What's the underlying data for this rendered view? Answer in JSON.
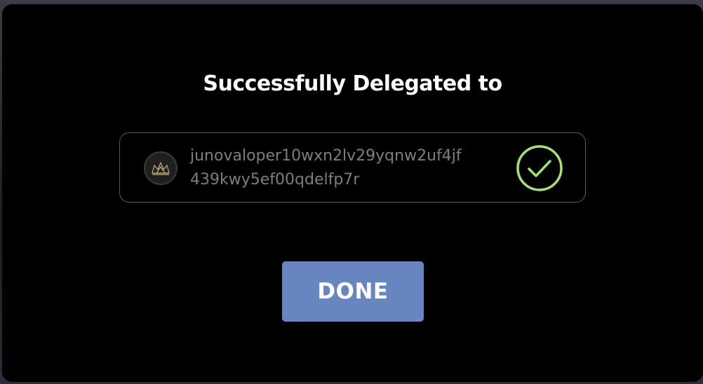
{
  "modal": {
    "title": "Successfully Delegated to",
    "validator": {
      "address_line1": "junovaloper10wxn2lv29yqnw2uf4jf",
      "address_line2": "439kwy5ef00qdelfp7r",
      "avatar_icon": "crown-icon",
      "status_icon": "check-circle-icon"
    },
    "done_label": "DONE"
  },
  "colors": {
    "modal_background": "#000000",
    "button": "#6786c0",
    "success": "#a4e07a",
    "address_text": "#7d7d7d",
    "avatar_gold": "#b49b6c"
  }
}
